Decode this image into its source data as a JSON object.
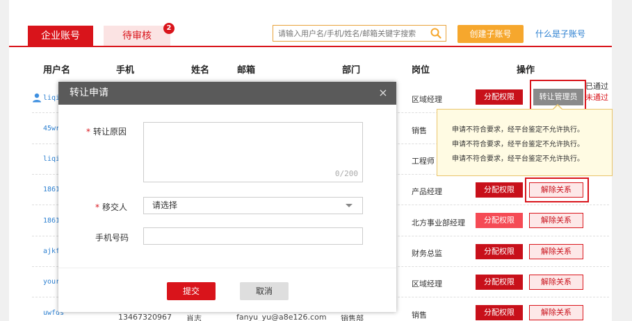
{
  "tabs": [
    {
      "label": "企业账号",
      "active": true
    },
    {
      "label": "待审核",
      "badge": "2"
    }
  ],
  "search": {
    "placeholder": "请输入用户名/手机/姓名/邮箱关键字搜索"
  },
  "create_button": "创建子账号",
  "help_link": "什么是子账号",
  "table": {
    "headers": [
      "用户名",
      "手机",
      "姓名",
      "邮箱",
      "部门",
      "岗位",
      "操作"
    ],
    "rows": [
      {
        "username": "liqi",
        "position": "区域经理"
      },
      {
        "username": "45wr",
        "position": "销售"
      },
      {
        "username": "liqi",
        "position": "工程师"
      },
      {
        "username": "1861",
        "position": "产品经理"
      },
      {
        "username": "1861",
        "position": "北方事业部经理"
      },
      {
        "username": "ajkf",
        "position": "财务总监"
      },
      {
        "username": "your",
        "position": "区域经理"
      },
      {
        "username": "uwfds",
        "phone": "13467320967",
        "name": "肖志",
        "email": "fanyu_yu@a8e126.com",
        "dept": "销售部",
        "position": "销售"
      }
    ],
    "assign_label": "分配权限",
    "unbind_label": "解除关系",
    "transfer_label": "转让管理员",
    "status_approved": "已通过",
    "status_rejected": "未通过"
  },
  "tooltip": {
    "lines": [
      "申请不符合要求，经平台鉴定不允许执行。",
      "申请不符合要求，经平台鉴定不允许执行。",
      "申请不符合要求，经平台鉴定不允许执行。"
    ]
  },
  "modal": {
    "title": "转让申请",
    "close": "×",
    "reason_label": "转让原因",
    "reason_counter": "0/200",
    "assignee_label": "移交人",
    "assignee_value": "请选择",
    "phone_label": "手机号码",
    "submit": "提交",
    "cancel": "取消"
  },
  "colors": {
    "brand_red": "#d9141b",
    "create_orange": "#f6a72d",
    "link_blue": "#2b7fd0",
    "modal_header": "#5a5a5a"
  }
}
